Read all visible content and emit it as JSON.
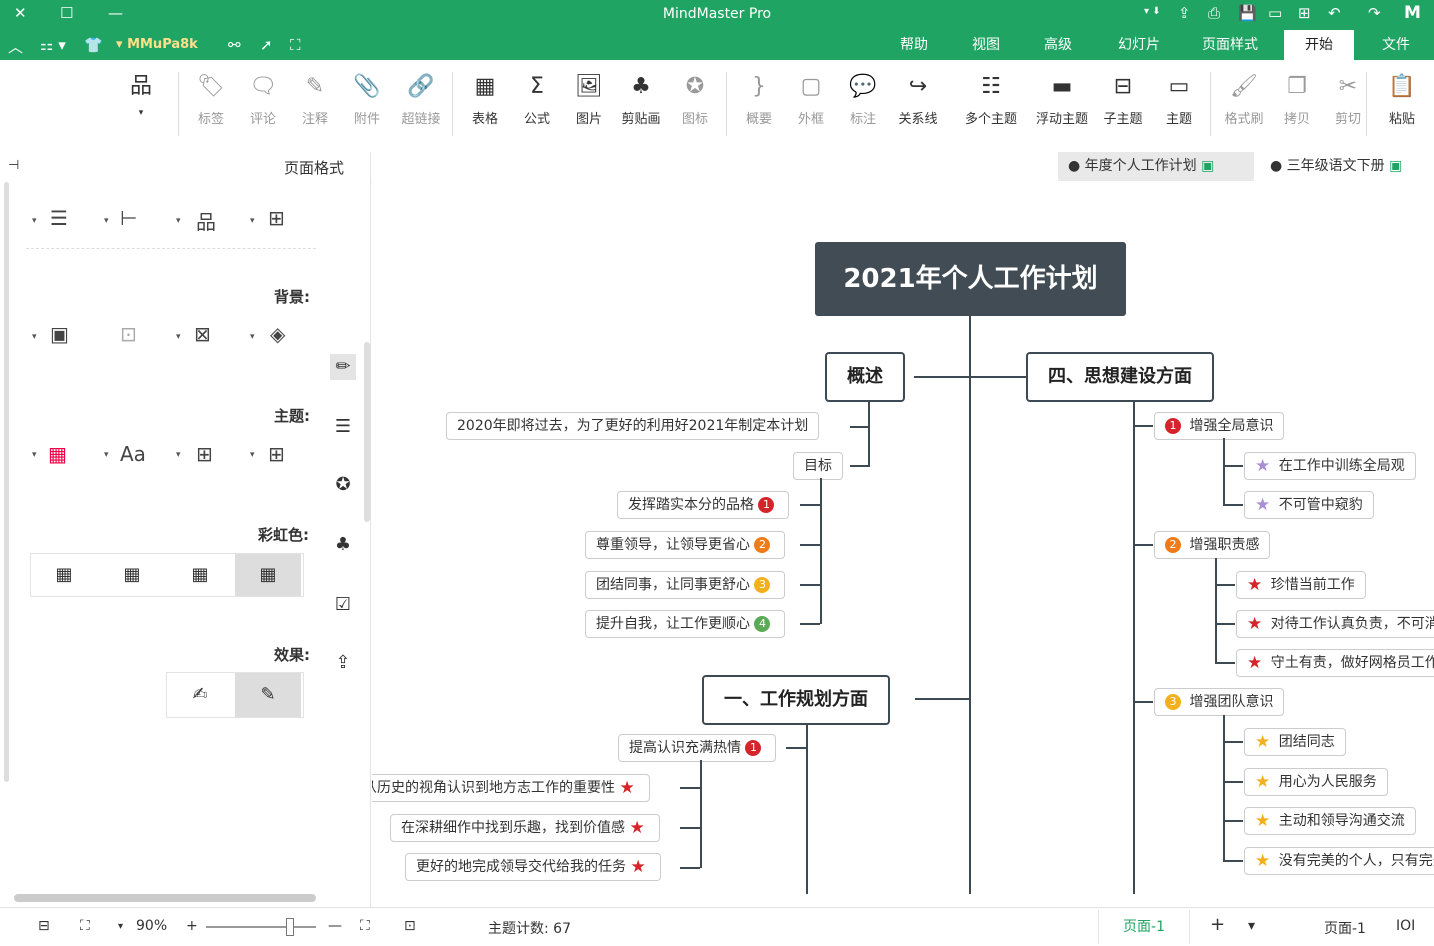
{
  "app": {
    "title": "MindMaster Pro"
  },
  "menu": {
    "tabs": [
      "文件",
      "开始",
      "页面样式",
      "幻灯片",
      "高级",
      "视图",
      "帮助"
    ],
    "active": "开始",
    "user": "MMuPa8k"
  },
  "ribbon": {
    "buttons": [
      {
        "label": "粘贴",
        "icon": "paste-icon",
        "glyph": "📋"
      },
      {
        "label": "剪切",
        "icon": "cut-icon",
        "glyph": "✂"
      },
      {
        "label": "拷贝",
        "icon": "copy-icon",
        "glyph": "❐"
      },
      {
        "label": "格式刷",
        "icon": "format-painter-icon",
        "glyph": "🖌"
      },
      {
        "label": "主题",
        "icon": "topic-icon",
        "glyph": "▭"
      },
      {
        "label": "子主题",
        "icon": "subtopic-icon",
        "glyph": "⊟"
      },
      {
        "label": "浮动主题",
        "icon": "floating-topic-icon",
        "glyph": "▬"
      },
      {
        "label": "多个主题",
        "icon": "multiple-topics-icon",
        "glyph": "☷"
      },
      {
        "label": "关系线",
        "icon": "relationship-icon",
        "glyph": "↪"
      },
      {
        "label": "标注",
        "icon": "callout-icon",
        "glyph": "💬"
      },
      {
        "label": "外框",
        "icon": "boundary-icon",
        "glyph": "▢"
      },
      {
        "label": "概要",
        "icon": "summary-icon",
        "glyph": "}"
      },
      {
        "label": "图标",
        "icon": "emblem-icon",
        "glyph": "✪"
      },
      {
        "label": "剪贴画",
        "icon": "clipart-icon",
        "glyph": "♣"
      },
      {
        "label": "图片",
        "icon": "picture-icon",
        "glyph": "🖼"
      },
      {
        "label": "公式",
        "icon": "formula-icon",
        "glyph": "Σ"
      },
      {
        "label": "表格",
        "icon": "table-icon",
        "glyph": "▦"
      },
      {
        "label": "超链接",
        "icon": "hyperlink-icon",
        "glyph": "🔗"
      },
      {
        "label": "附件",
        "icon": "attachment-icon",
        "glyph": "📎"
      },
      {
        "label": "注释",
        "icon": "note-icon",
        "glyph": "✎"
      },
      {
        "label": "评论",
        "icon": "comment-icon",
        "glyph": "🗨"
      },
      {
        "label": "标签",
        "icon": "tag-icon",
        "glyph": "🏷"
      }
    ]
  },
  "doc_tabs": [
    "三年级语文下册",
    "年度个人工作计划"
  ],
  "panel": {
    "title": "页面格式",
    "sections": {
      "background": "背景:",
      "theme": "主题:",
      "rainbow": "彩虹色:",
      "effect": "效果:"
    }
  },
  "mindmap": {
    "root": "2021年个人工作计划",
    "left": {
      "overview": {
        "title": "概述",
        "intro": "2020年即将过去，为了更好的利用好2021年制定本计划",
        "goal_label": "目标",
        "goals": [
          {
            "n": "1",
            "color": "#d6242b",
            "text": "发挥踏实本分的品格"
          },
          {
            "n": "2",
            "color": "#ef7c1b",
            "text": "尊重领导，让领导更省心"
          },
          {
            "n": "3",
            "color": "#f2b11b",
            "text": "团结同事，让同事更舒心"
          },
          {
            "n": "4",
            "color": "#5aaa58",
            "text": "提升自我，让工作更顺心"
          }
        ]
      },
      "planning": {
        "title": "一、工作规划方面",
        "item1": {
          "n": "1",
          "color": "#d6242b",
          "text": "提高认识充满热情"
        },
        "subs": [
          "从历史的视角认识到地方志工作的重要性",
          "在深耕细作中找到乐趣，找到价值感",
          "更好的地完成领导交代给我的任务"
        ]
      }
    },
    "right": {
      "ideology": {
        "title": "四、思想建设方面",
        "groups": [
          {
            "n": "1",
            "color": "#d6242b",
            "text": "增强全局意识",
            "star": "#a98fd4",
            "subs": [
              "在工作中训练全局观",
              "不可管中窥豹"
            ]
          },
          {
            "n": "2",
            "color": "#ef7c1b",
            "text": "增强职责感",
            "star": "#d6242b",
            "subs": [
              "珍惜当前工作",
              "对待工作认真负责，不可消极懈怠",
              "守土有责，做好网格员工作"
            ]
          },
          {
            "n": "3",
            "color": "#f2b11b",
            "text": "增强团队意识",
            "star": "#f2b11b",
            "subs": [
              "团结同志",
              "用心为人民服务",
              "主动和领导沟通交流",
              "没有完美的个人，只有完美的集体"
            ]
          }
        ]
      }
    }
  },
  "status": {
    "topic_count": "主题计数: 67",
    "zoom": "90%",
    "page_tab": "页面-1",
    "page_tab_active": "页面-1"
  }
}
